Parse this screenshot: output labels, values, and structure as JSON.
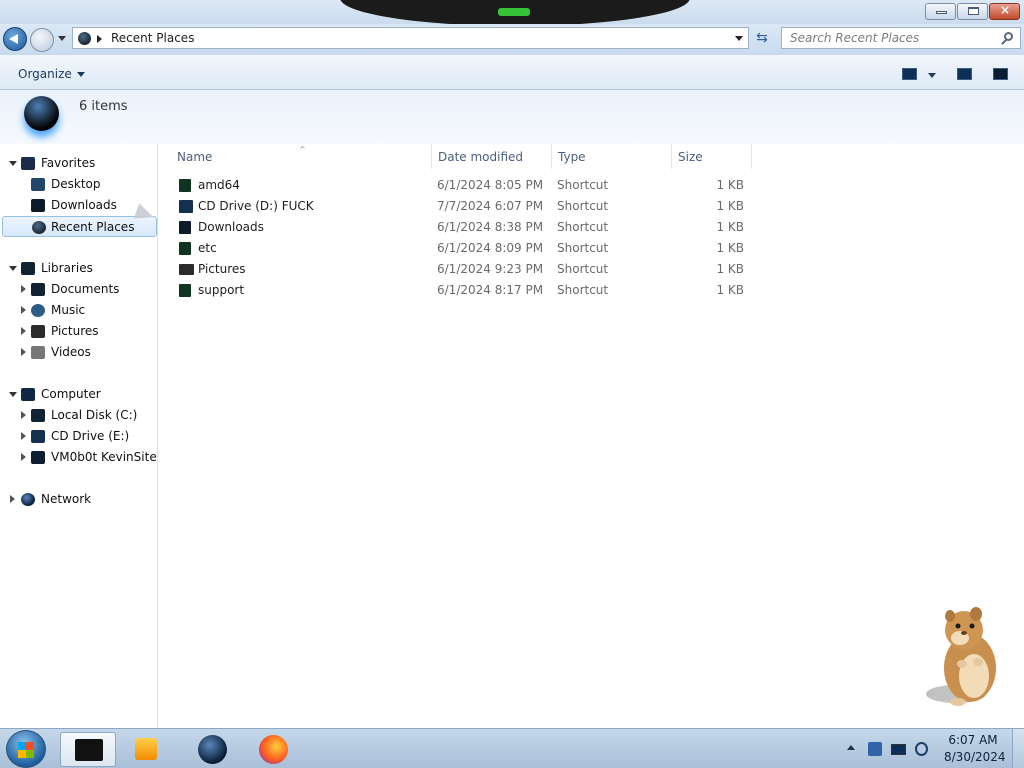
{
  "window": {
    "controls": {
      "minimize_icon": "minimize-icon",
      "maximize_icon": "maximize-icon",
      "close_label": "×"
    }
  },
  "nav": {
    "address_path": "Recent Places",
    "search_placeholder": "Search Recent Places"
  },
  "toolbar": {
    "organize_label": "Organize"
  },
  "details": {
    "item_count": "6 items"
  },
  "navpane": {
    "favorites": {
      "label": "Favorites",
      "items": [
        {
          "label": "Desktop"
        },
        {
          "label": "Downloads"
        },
        {
          "label": "Recent Places",
          "selected": true
        }
      ]
    },
    "libraries": {
      "label": "Libraries",
      "items": [
        {
          "label": "Documents"
        },
        {
          "label": "Music"
        },
        {
          "label": "Pictures"
        },
        {
          "label": "Videos"
        }
      ]
    },
    "computer": {
      "label": "Computer",
      "items": [
        {
          "label": "Local Disk (C:)"
        },
        {
          "label": "CD Drive (E:)"
        },
        {
          "label": "VM0b0t KevinSite"
        }
      ]
    },
    "network": {
      "label": "Network"
    }
  },
  "filelist": {
    "columns": {
      "name": "Name",
      "date": "Date modified",
      "type": "Type",
      "size": "Size"
    },
    "rows": [
      {
        "name": "amd64",
        "date": "6/1/2024 8:05 PM",
        "type": "Shortcut",
        "size": "1 KB"
      },
      {
        "name": "CD Drive (D:) FUCK",
        "date": "7/7/2024 6:07 PM",
        "type": "Shortcut",
        "size": "1 KB"
      },
      {
        "name": "Downloads",
        "date": "6/1/2024 8:38 PM",
        "type": "Shortcut",
        "size": "1 KB"
      },
      {
        "name": "etc",
        "date": "6/1/2024 8:09 PM",
        "type": "Shortcut",
        "size": "1 KB"
      },
      {
        "name": "Pictures",
        "date": "6/1/2024 9:23 PM",
        "type": "Shortcut",
        "size": "1 KB"
      },
      {
        "name": "support",
        "date": "6/1/2024 8:17 PM",
        "type": "Shortcut",
        "size": "1 KB"
      }
    ]
  },
  "taskbar": {
    "clock_time": "6:07 AM",
    "clock_date": "8/30/2024"
  }
}
